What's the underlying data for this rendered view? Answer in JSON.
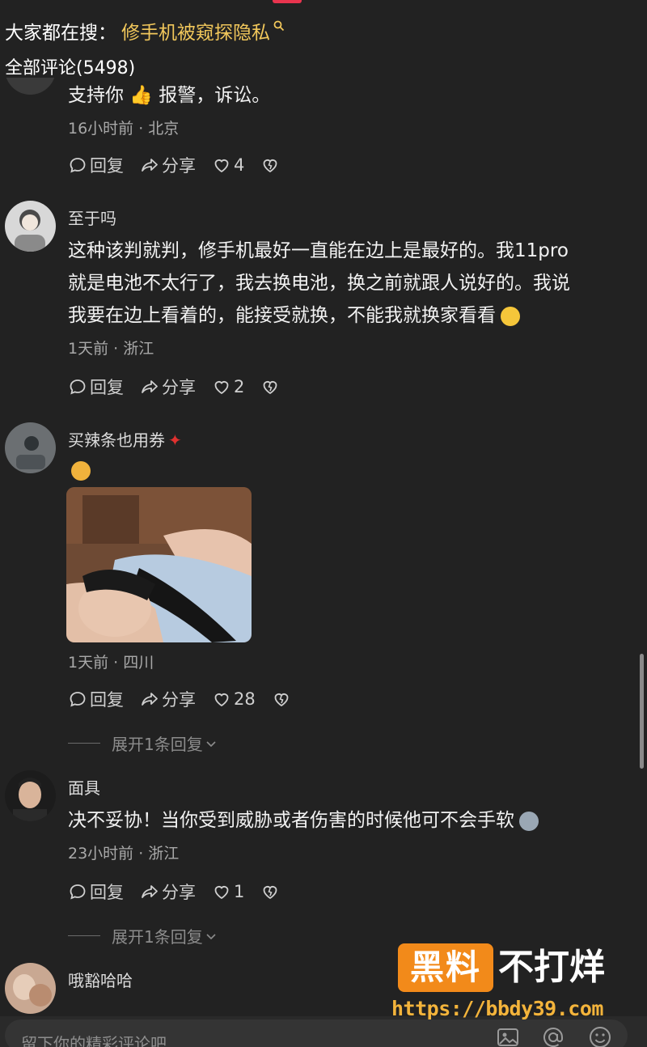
{
  "hot_search": {
    "label": "大家都在搜：",
    "query": "修手机被窥探隐私"
  },
  "comments_header": "全部评论(5498)",
  "actions": {
    "reply": "回复",
    "share": "分享"
  },
  "comments": [
    {
      "content": "支持你 👍 报警，诉讼。",
      "meta": "16小时前 · 北京",
      "likes": "4"
    },
    {
      "username": "至于吗",
      "content_lines": [
        "这种该判就判，修手机最好一直能在边上是最好的。我11pro",
        "就是电池不太行了，我去换电池，换之前就跟人说好的。我说",
        "我要在边上看着的，能接受就换，不能我就换家看看"
      ],
      "meta": "1天前 · 浙江",
      "likes": "2"
    },
    {
      "username": "买辣条也用券",
      "meta": "1天前 · 四川",
      "likes": "28",
      "expand": "展开1条回复"
    },
    {
      "username": "面具",
      "content": "决不妥协！当你受到威胁或者伤害的时候他可不会手软",
      "meta": "23小时前 · 浙江",
      "likes": "1",
      "expand": "展开1条回复"
    },
    {
      "username": "哦豁哈哈"
    }
  ],
  "input": {
    "placeholder": "留下你的精彩评论吧"
  },
  "watermark": {
    "box": "黑料",
    "text": "不打烊",
    "url": "https://bbdy39.com"
  },
  "colors": {
    "background": "#222222",
    "highlight": "#f1c75b",
    "accent": "#e8344e",
    "watermark_orange": "#f28a1a"
  }
}
